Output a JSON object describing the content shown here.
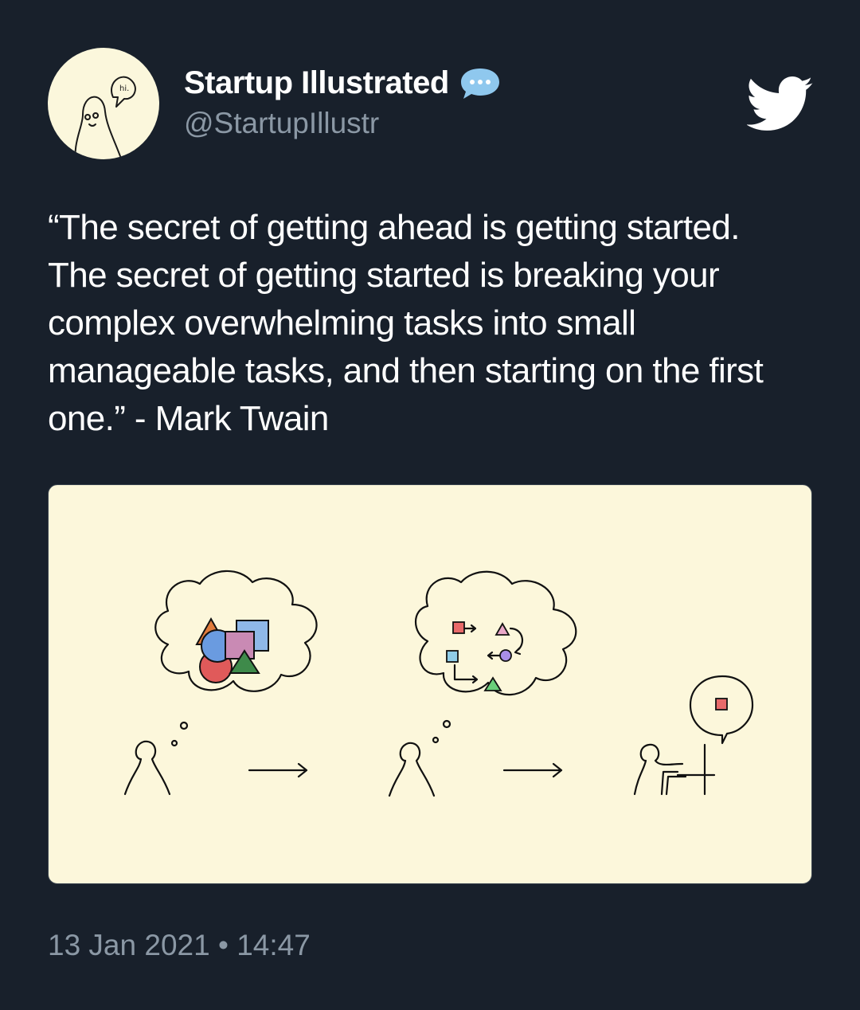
{
  "tweet": {
    "author": {
      "display_name": "Startup Illustrated",
      "handle": "@StartupIllustr",
      "avatar_speech_text": "hi."
    },
    "text": "“The secret of getting ahead is getting started.\nThe secret of getting started is breaking your\ncomplex overwhelming tasks into small\nmanageable tasks, and then starting on the first\none.” - Mark Twain",
    "date": "13 Jan 2021",
    "separator": "•",
    "time": "14:47"
  },
  "icons": {
    "verified_badge": "speech-bubble-dots-icon",
    "platform_logo": "twitter-bird-icon"
  },
  "colors": {
    "background": "#18202b",
    "secondary_text": "#8b98a5",
    "badge": "#8fc8ee",
    "illustration_bg": "#fcf7db"
  }
}
